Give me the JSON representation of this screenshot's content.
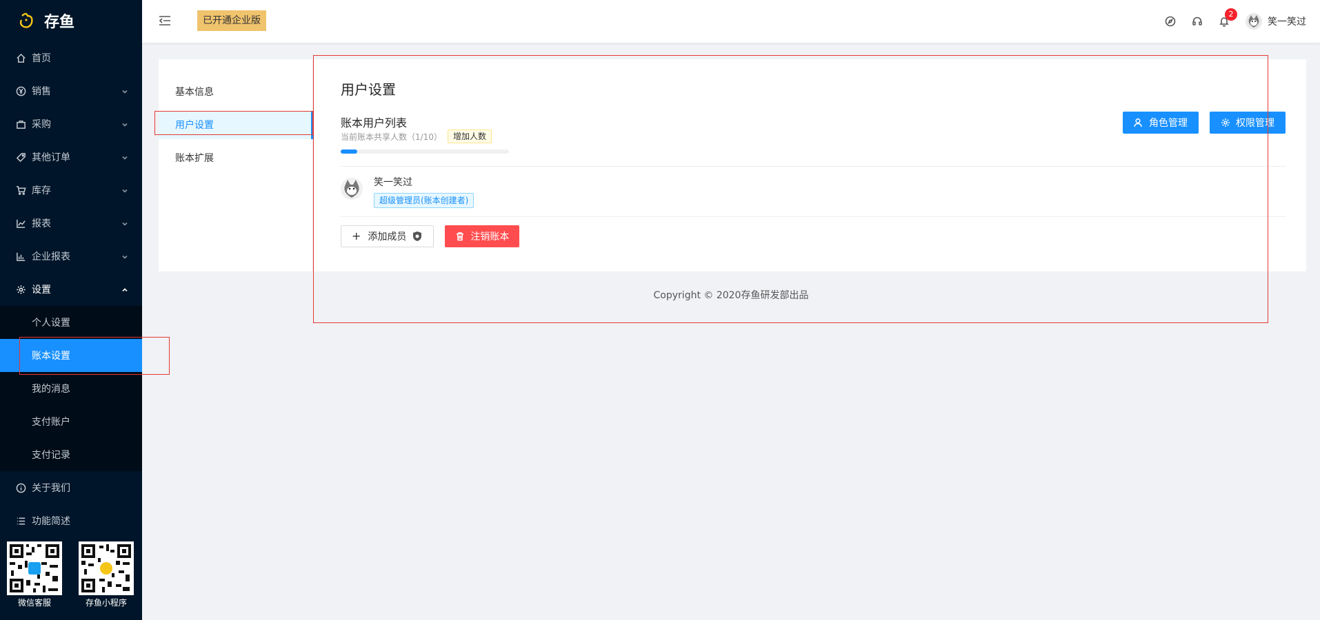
{
  "app": {
    "name": "存鱼"
  },
  "sidebar": {
    "items": [
      {
        "label": "首页",
        "icon": "home-icon"
      },
      {
        "label": "销售",
        "icon": "yen-icon"
      },
      {
        "label": "采购",
        "icon": "bag-icon"
      },
      {
        "label": "其他订单",
        "icon": "tag-icon"
      },
      {
        "label": "库存",
        "icon": "cart-icon"
      },
      {
        "label": "报表",
        "icon": "line-chart-icon"
      },
      {
        "label": "企业报表",
        "icon": "bar-chart-icon"
      },
      {
        "label": "设置",
        "icon": "gear-icon"
      }
    ],
    "settings_sub": [
      {
        "label": "个人设置"
      },
      {
        "label": "账本设置"
      },
      {
        "label": "我的消息"
      },
      {
        "label": "支付账户"
      },
      {
        "label": "支付记录"
      }
    ],
    "after_items": [
      {
        "label": "关于我们",
        "icon": "info-icon"
      },
      {
        "label": "功能简述",
        "icon": "list-icon"
      }
    ],
    "qr": [
      {
        "label": "微信客服"
      },
      {
        "label": "存鱼小程序"
      }
    ]
  },
  "header": {
    "enterprise_badge": "已开通企业版",
    "notification_count": "2",
    "user_name": "笑一笑过"
  },
  "tabs": [
    {
      "label": "基本信息"
    },
    {
      "label": "用户设置"
    },
    {
      "label": "账本扩展"
    }
  ],
  "panel": {
    "title": "用户设置",
    "list_title": "账本用户列表",
    "share_text": "当前账本共享人数（1/10）",
    "add_count": "增加人数",
    "progress_fraction": 0.1,
    "role_button": "角色管理",
    "perm_button": "权限管理",
    "member": {
      "name": "笑一笑过",
      "role": "超级管理员(账本创建者)"
    },
    "add_member": "添加成员",
    "cancel_ledger": "注销账本"
  },
  "footer": {
    "copyright": "Copyright © 2020存鱼研发部出品"
  },
  "colors": {
    "sidebar": "#001529",
    "accent": "#1890ff",
    "danger": "#ff4d4f",
    "badge": "#f0c36d"
  }
}
